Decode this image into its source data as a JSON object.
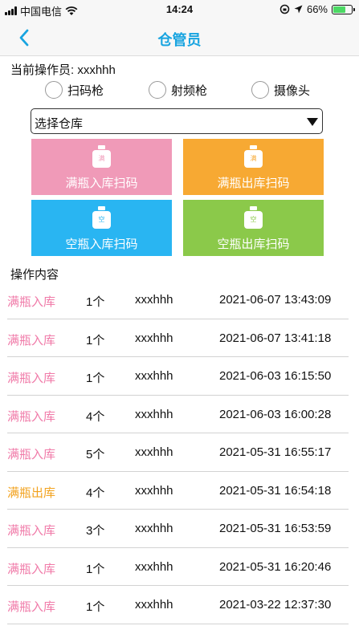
{
  "status_bar": {
    "carrier": "中国电信",
    "time": "14:24",
    "battery": "66%",
    "battery_level": 0.66
  },
  "nav": {
    "title": "仓管员",
    "back_icon": "chevron-left-icon"
  },
  "operator": {
    "label": "当前操作员: xxxhhh"
  },
  "scan_modes": [
    {
      "label": "扫码枪"
    },
    {
      "label": "射频枪"
    },
    {
      "label": "摄像头"
    }
  ],
  "warehouse_select": {
    "label": "选择仓库"
  },
  "tiles": [
    {
      "label": "满瓶入库扫码",
      "icon_text": "满",
      "color": "#f09ab8"
    },
    {
      "label": "满瓶出库扫码",
      "icon_text": "满",
      "color": "#f7a933"
    },
    {
      "label": "空瓶入库扫码",
      "icon_text": "空",
      "color": "#29b5f2"
    },
    {
      "label": "空瓶出库扫码",
      "icon_text": "空",
      "color": "#8bc94a"
    }
  ],
  "records_title": "操作内容",
  "colors": {
    "in": "#f07aa8",
    "out": "#f2a21e",
    "title": "#18a4e0"
  },
  "records": [
    {
      "type": "满瓶入库",
      "kind": "in",
      "qty": "1个",
      "user": "xxxhhh",
      "time": "2021-06-07 13:43:09"
    },
    {
      "type": "满瓶入库",
      "kind": "in",
      "qty": "1个",
      "user": "xxxhhh",
      "time": "2021-06-07 13:41:18"
    },
    {
      "type": "满瓶入库",
      "kind": "in",
      "qty": "1个",
      "user": "xxxhhh",
      "time": "2021-06-03 16:15:50"
    },
    {
      "type": "满瓶入库",
      "kind": "in",
      "qty": "4个",
      "user": "xxxhhh",
      "time": "2021-06-03 16:00:28"
    },
    {
      "type": "满瓶入库",
      "kind": "in",
      "qty": "5个",
      "user": "xxxhhh",
      "time": "2021-05-31 16:55:17"
    },
    {
      "type": "满瓶出库",
      "kind": "out",
      "qty": "4个",
      "user": "xxxhhh",
      "time": "2021-05-31 16:54:18"
    },
    {
      "type": "满瓶入库",
      "kind": "in",
      "qty": "3个",
      "user": "xxxhhh",
      "time": "2021-05-31 16:53:59"
    },
    {
      "type": "满瓶入库",
      "kind": "in",
      "qty": "1个",
      "user": "xxxhhh",
      "time": "2021-05-31 16:20:46"
    },
    {
      "type": "满瓶入库",
      "kind": "in",
      "qty": "1个",
      "user": "xxxhhh",
      "time": "2021-03-22 12:37:30"
    }
  ]
}
